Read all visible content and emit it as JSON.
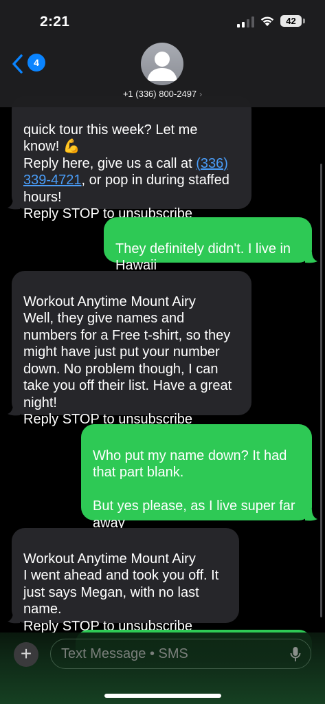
{
  "status_bar": {
    "time": "2:21",
    "battery": "42"
  },
  "header": {
    "back_count": "4",
    "contact": "+1 (336) 800-2497",
    "chevron": "›"
  },
  "messages": [
    {
      "direction": "in",
      "line1": "quick tour this week? Let me\nknow! ",
      "emoji": "💪",
      "line2": "\n Reply here, give us a call at ",
      "link": "(336)\n339-4721",
      "line3": ", or pop in during staffed\nhours!\nReply STOP to unsubscribe"
    },
    {
      "direction": "out",
      "text": "They definitely didn't. I live in\nHawaii"
    },
    {
      "direction": "in",
      "text": "Workout Anytime Mount Airy\nWell, they give names and\nnumbers for a Free t-shirt, so they\nmight have just put your number\ndown. No problem though, I can\ntake you off their list. Have a great\nnight!\nReply STOP to unsubscribe"
    },
    {
      "direction": "out",
      "text": "Who put my name down? It had\nthat part blank.\n\nBut yes please, as I live super far\naway"
    },
    {
      "direction": "in",
      "text": "Workout Anytime Mount Airy\nI went ahead and took you off. It\njust says Megan, with no last\nname.\nReply STOP to unsubscribe"
    }
  ],
  "composer": {
    "placeholder": "Text Message • SMS",
    "plus": "+"
  },
  "colors": {
    "incoming": "#26262a",
    "outgoing": "#2ec955",
    "link": "#4a9df8",
    "badge": "#0a84ff"
  }
}
